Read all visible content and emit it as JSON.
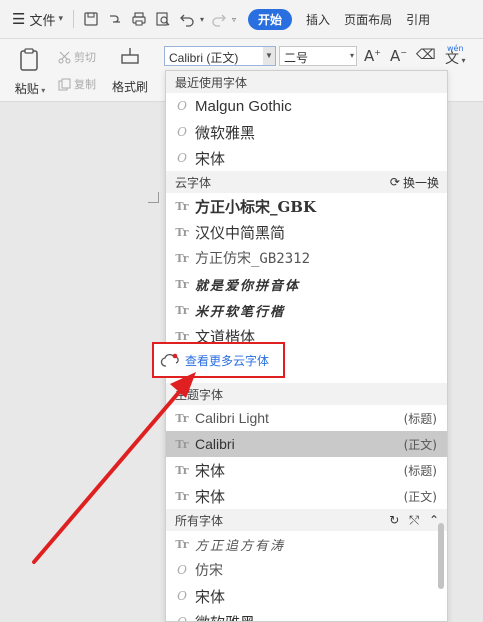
{
  "menubar": {
    "file_label": "文件",
    "tabs": [
      {
        "label": "开始",
        "active": true
      },
      {
        "label": "插入",
        "active": false
      },
      {
        "label": "页面布局",
        "active": false
      },
      {
        "label": "引用",
        "active": false
      }
    ]
  },
  "ribbon": {
    "paste_label": "粘贴",
    "cut_label": "剪切",
    "copy_label": "复制",
    "format_painter_label": "格式刷",
    "font_name": "Calibri (正文)",
    "font_size": "二号",
    "clear_format_label": "文",
    "pinyin_label": "wén",
    "pinyin_char": "文"
  },
  "dropdown": {
    "recent_header": "最近使用字体",
    "recent_fonts": [
      "Malgun Gothic",
      "微软雅黑",
      "宋体"
    ],
    "cloud_header": "云字体",
    "cloud_refresh_label": "换一换",
    "cloud_fonts": [
      "方正小标宋_GBK",
      "汉仪中简黑简",
      "方正仿宋_GB2312",
      "就是爱你拼音体",
      "米开软笔行楷",
      "文道楷体"
    ],
    "more_cloud_label": "查看更多云字体",
    "theme_header": "主题字体",
    "theme_fonts": [
      {
        "name": "Calibri Light",
        "tag": "(标题)"
      },
      {
        "name": "Calibri",
        "tag": "(正文)"
      },
      {
        "name": "宋体",
        "tag": "(标题)"
      },
      {
        "name": "宋体",
        "tag": "(正文)"
      }
    ],
    "all_header": "所有字体",
    "all_fonts": [
      "方正追方有涛",
      "仿宋",
      "宋体",
      "微软雅黑"
    ]
  },
  "colors": {
    "accent": "#2a6fe0",
    "highlight_red": "#e02020",
    "selected_row": "#c9c9c9"
  }
}
